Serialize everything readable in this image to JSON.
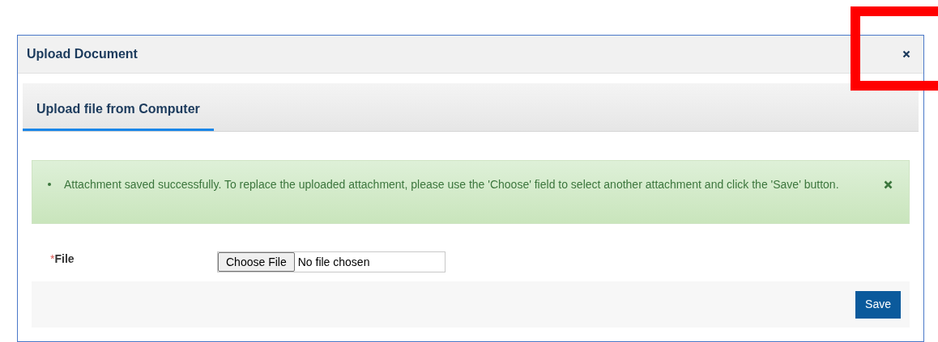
{
  "window": {
    "title": "Upload Document"
  },
  "tabs": [
    {
      "label": "Upload file from Computer",
      "selected": true
    }
  ],
  "alert": {
    "kind": "success",
    "messages": [
      "Attachment saved successfully. To replace the uploaded attachment, please use the 'Choose' field to select another attachment and click the 'Save' button."
    ]
  },
  "form": {
    "fields": [
      {
        "label": "File",
        "required": true,
        "required_mark": "*",
        "button": "Choose File",
        "value": "No file chosen"
      }
    ]
  },
  "buttons": [
    "Save"
  ],
  "annotation": {
    "kind": "highlight",
    "color": "#ff0000"
  }
}
